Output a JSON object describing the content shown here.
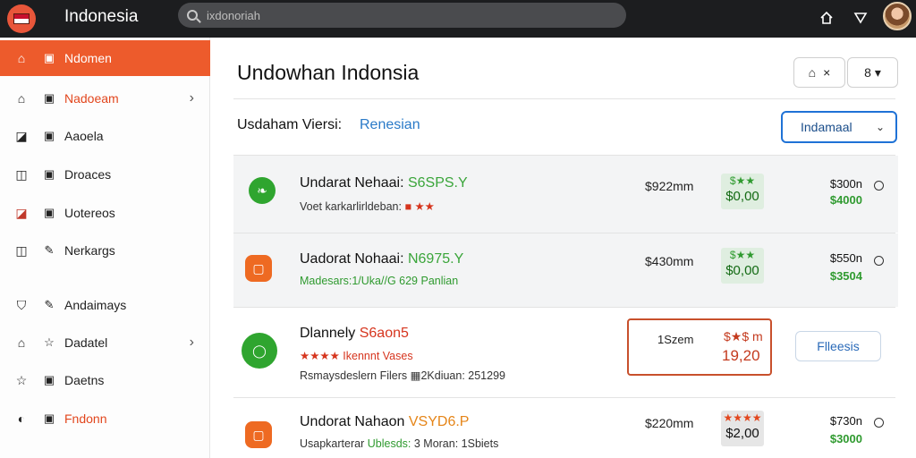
{
  "header": {
    "app_title": "Indonesia",
    "search_placeholder": "ixdonoriah",
    "icons": [
      "home-icon",
      "filter-icon",
      "avatar"
    ]
  },
  "sidebar": {
    "items": [
      {
        "icon": "home-icon",
        "icon2": "grid-icon",
        "label": "Ndomen",
        "active": true
      },
      {
        "icon": "house-icon",
        "icon2": "grid-icon",
        "label": "Nadoeam",
        "chevron": true,
        "orange": true
      },
      {
        "icon": "chart-icon",
        "icon2": "grid-icon",
        "label": "Aaoela"
      },
      {
        "icon": "box-icon",
        "icon2": "grid-icon",
        "label": "Droaces"
      },
      {
        "icon": "bar-chart-icon",
        "icon2": "grid-icon",
        "label": "Uotereos"
      },
      {
        "icon": "box-icon",
        "icon2": "edit-icon",
        "label": "Nerkargs"
      },
      {
        "icon": "shield-icon",
        "icon2": "edit-icon",
        "label": "Andaimays"
      },
      {
        "icon": "house-icon",
        "icon2": "star-icon",
        "label": "Dadatel",
        "chevron": true
      },
      {
        "icon": "star-icon",
        "icon2": "grid-icon",
        "label": "Daetns"
      },
      {
        "icon": "clock-icon",
        "icon2": "grid-icon",
        "label": "Fndonn",
        "orange": true
      }
    ]
  },
  "main": {
    "title": "Undowhan Indonsia",
    "header_buttons": [
      {
        "icon": "tag-icon",
        "label": "×"
      },
      {
        "icon": "",
        "label": "8 ▾"
      }
    ],
    "filter": {
      "label": "Usdaham Viersi:",
      "value": "Renesian"
    },
    "select": {
      "value": "Indamaal"
    },
    "rows": [
      {
        "icon": "leaf-icon",
        "icon_style": "green",
        "title": "Undarat Nehaai:",
        "title_highlight": "S6SPS.Y",
        "highlight_class": "hl-green",
        "sub": "Voet karkarlirldeban:",
        "sub_extra": "■ ★★",
        "sub_class": "",
        "price": "$922mm",
        "badge_stars": "$★★",
        "badge_value": "$0,00",
        "price2": "$300n",
        "price3": "$4000"
      },
      {
        "icon": "square-icon",
        "icon_style": "orange",
        "title": "Uadorat Nohaai:",
        "title_highlight": "N6975.Y",
        "highlight_class": "hl-green",
        "sub": "Madesars:1/Uka//G 629 Panlian",
        "sub_extra": "",
        "sub_class": "green",
        "price": "$430mm",
        "badge_stars": "$★★",
        "badge_value": "$0,00",
        "price2": "$550n",
        "price3": "$3504"
      },
      {
        "icon": "circle-icon",
        "icon_style": "green",
        "title": "Dlannely",
        "title_highlight": "S6aon5",
        "highlight_class": "hl-red",
        "sub": "★★★★ Ikennnt Vases",
        "sub2": "Rsmaysdeslern Filers ▦2Kdiuan: 251299",
        "box_a": "1Szem",
        "box_b": "$★$ m",
        "box_c": "19,20",
        "button": "Flleesis"
      },
      {
        "icon": "square-icon",
        "icon_style": "orange",
        "title": "Undorat Nahaon",
        "title_highlight": "VSYD6.P",
        "highlight_class": "hl-orange",
        "sub": "Usapkarterar",
        "sub_green": "Ublesds:",
        "sub_tail": "3 Moran: 1Sbiets",
        "price": "$220mm",
        "badge_stars": "★★★★",
        "badge_value": "$2,00",
        "price2": "$730n",
        "price3": "$3000"
      }
    ]
  }
}
